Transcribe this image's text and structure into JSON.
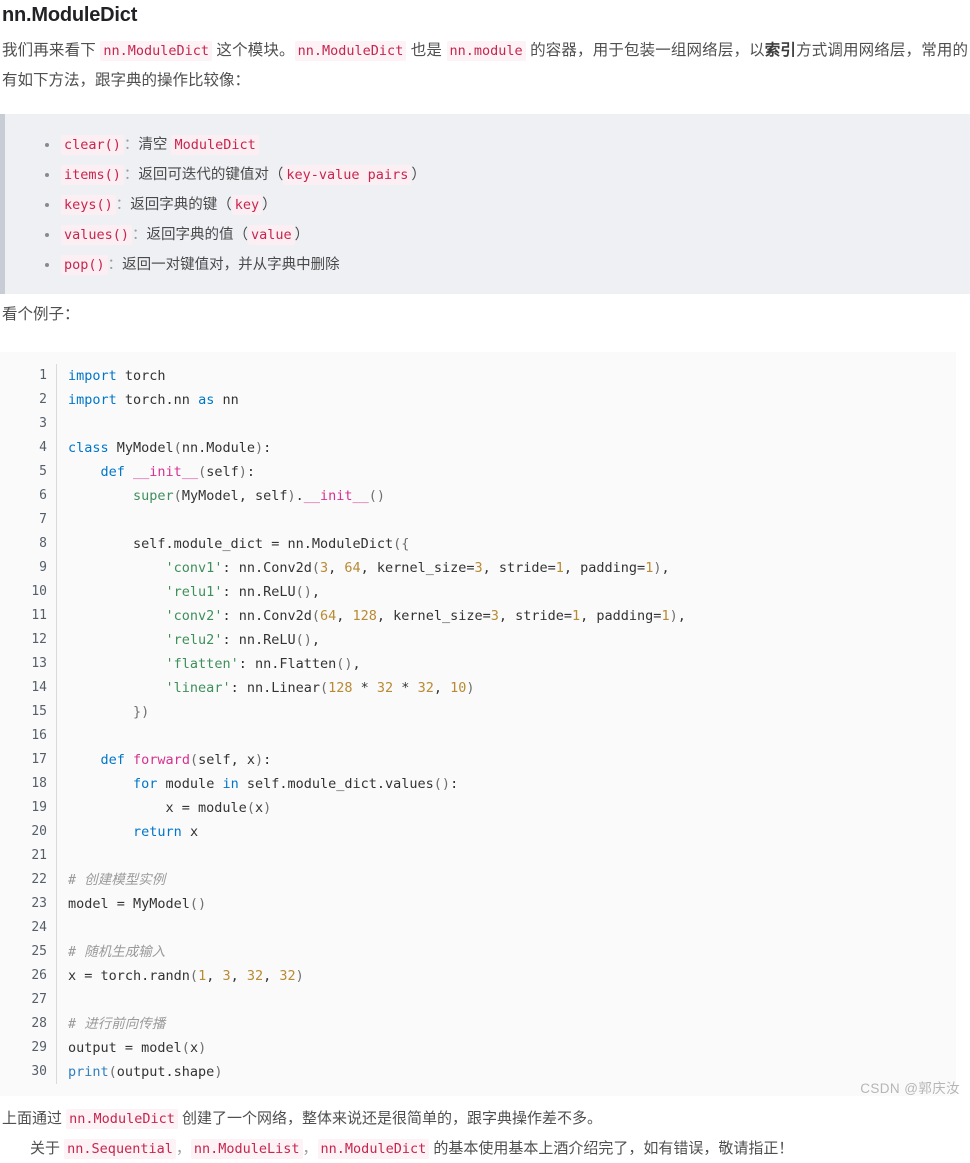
{
  "document": {
    "title": "nn.ModuleDict",
    "intro": {
      "seg1": "我们再来看下 ",
      "code1": "nn.ModuleDict",
      "seg2": " 这个模块。",
      "code2": "nn.ModuleDict",
      "seg3": " 也是 ",
      "code3": "nn.module",
      "seg4": " 的容器，用于包装一组网络层，以",
      "bold": "索引",
      "seg5": "方式调用网络层，常用的有如下方法，跟字典的操作比较像："
    },
    "methods_panel": {
      "items": [
        {
          "code": "clear()",
          "sep": "：",
          "desc_pre": "清空 ",
          "desc_code": "ModuleDict",
          "desc_post": ""
        },
        {
          "code": "items()",
          "sep": "：",
          "desc_pre": "返回可迭代的键值对（",
          "desc_code": "key-value pairs",
          "desc_post": "）"
        },
        {
          "code": "keys()",
          "sep": "：",
          "desc_pre": "返回字典的键（",
          "desc_code": "key",
          "desc_post": "）"
        },
        {
          "code": "values()",
          "sep": "：",
          "desc_pre": "返回字典的值（",
          "desc_code": "value",
          "desc_post": "）"
        },
        {
          "code": "pop()",
          "sep": "：",
          "desc_pre": "返回一对键值对，并从字典中删除",
          "desc_code": "",
          "desc_post": ""
        }
      ]
    },
    "example_label": "看个例子：",
    "code_block": {
      "language": "python",
      "lines": [
        {
          "n": "1",
          "html": "<span class='k'>import</span> torch"
        },
        {
          "n": "2",
          "html": "<span class='k'>import</span> torch.nn <span class='k'>as</span> nn"
        },
        {
          "n": "3",
          "html": ""
        },
        {
          "n": "4",
          "html": "<span class='k'>class</span> MyModel<span class='pn'>(</span>nn.Module<span class='pn'>)</span>:"
        },
        {
          "n": "5",
          "html": "    <span class='k'>def</span> <span class='fn'>__init__</span><span class='pn'>(</span>self<span class='pn'>)</span>:"
        },
        {
          "n": "6",
          "html": "        <span class='bi'>super</span><span class='pn'>(</span>MyModel, self<span class='pn'>)</span>.<span class='fn'>__init__</span><span class='pn'>()</span>"
        },
        {
          "n": "7",
          "html": ""
        },
        {
          "n": "8",
          "html": "        self.module_dict = nn.ModuleDict<span class='pn'>({</span>"
        },
        {
          "n": "9",
          "html": "            <span class='st'>'conv1'</span>: nn.Conv2d<span class='pn'>(</span><span class='nu'>3</span>, <span class='nu'>64</span>, kernel_size=<span class='nu'>3</span>, stride=<span class='nu'>1</span>, padding=<span class='nu'>1</span><span class='pn'>)</span>,"
        },
        {
          "n": "10",
          "html": "            <span class='st'>'relu1'</span>: nn.ReLU<span class='pn'>()</span>,"
        },
        {
          "n": "11",
          "html": "            <span class='st'>'conv2'</span>: nn.Conv2d<span class='pn'>(</span><span class='nu'>64</span>, <span class='nu'>128</span>, kernel_size=<span class='nu'>3</span>, stride=<span class='nu'>1</span>, padding=<span class='nu'>1</span><span class='pn'>)</span>,"
        },
        {
          "n": "12",
          "html": "            <span class='st'>'relu2'</span>: nn.ReLU<span class='pn'>()</span>,"
        },
        {
          "n": "13",
          "html": "            <span class='st'>'flatten'</span>: nn.Flatten<span class='pn'>()</span>,"
        },
        {
          "n": "14",
          "html": "            <span class='st'>'linear'</span>: nn.Linear<span class='pn'>(</span><span class='nu'>128</span> * <span class='nu'>32</span> * <span class='nu'>32</span>, <span class='nu'>10</span><span class='pn'>)</span>"
        },
        {
          "n": "15",
          "html": "        <span class='pn'>})</span>"
        },
        {
          "n": "16",
          "html": ""
        },
        {
          "n": "17",
          "html": "    <span class='k'>def</span> <span class='fn'>forward</span><span class='pn'>(</span>self, x<span class='pn'>)</span>:"
        },
        {
          "n": "18",
          "html": "        <span class='k'>for</span> module <span class='k'>in</span> self.module_dict.values<span class='pn'>()</span>:"
        },
        {
          "n": "19",
          "html": "            x = module<span class='pn'>(</span>x<span class='pn'>)</span>"
        },
        {
          "n": "20",
          "html": "        <span class='k'>return</span> x"
        },
        {
          "n": "21",
          "html": ""
        },
        {
          "n": "22",
          "html": "<span class='cm'># 创建模型实例</span>"
        },
        {
          "n": "23",
          "html": "model = MyModel<span class='pn'>()</span>"
        },
        {
          "n": "24",
          "html": ""
        },
        {
          "n": "25",
          "html": "<span class='cm'># 随机生成输入</span>"
        },
        {
          "n": "26",
          "html": "x = torch.randn<span class='pn'>(</span><span class='nu'>1</span>, <span class='nu'>3</span>, <span class='nu'>32</span>, <span class='nu'>32</span><span class='pn'>)</span>"
        },
        {
          "n": "27",
          "html": ""
        },
        {
          "n": "28",
          "html": "<span class='cm'># 进行前向传播</span>"
        },
        {
          "n": "29",
          "html": "output = model<span class='pn'>(</span>x<span class='pn'>)</span>"
        },
        {
          "n": "30",
          "html": "<span class='pf'>print</span><span class='pn'>(</span>output.shape<span class='pn'>)</span>"
        }
      ]
    },
    "summary": {
      "line1_pre": "上面通过 ",
      "line1_code": "nn.ModuleDict",
      "line1_post": " 创建了一个网络，整体来说还是很简单的，跟字典操作差不多。",
      "line2_pre": "关于 ",
      "line2_code1": "nn.Sequential",
      "line2_sep1": "，",
      "line2_code2": "nn.ModuleList",
      "line2_sep2": "，",
      "line2_code3": "nn.ModuleDict",
      "line2_post": " 的基本使用基本上酒介绍完了，如有错误，敬请指正！"
    },
    "watermark": "CSDN @郭庆汝"
  },
  "colors": {
    "inline_code_text": "#c7254e",
    "inline_code_bg": "#fdf2f5",
    "panel_bg": "#eef0f4",
    "panel_border": "#c8ccd4",
    "code_bg": "#fafafa",
    "keyword": "#0076c9",
    "string": "#3f8f5b",
    "number": "#b88a33",
    "comment": "#9a9a9a",
    "function": "#d6318f"
  }
}
